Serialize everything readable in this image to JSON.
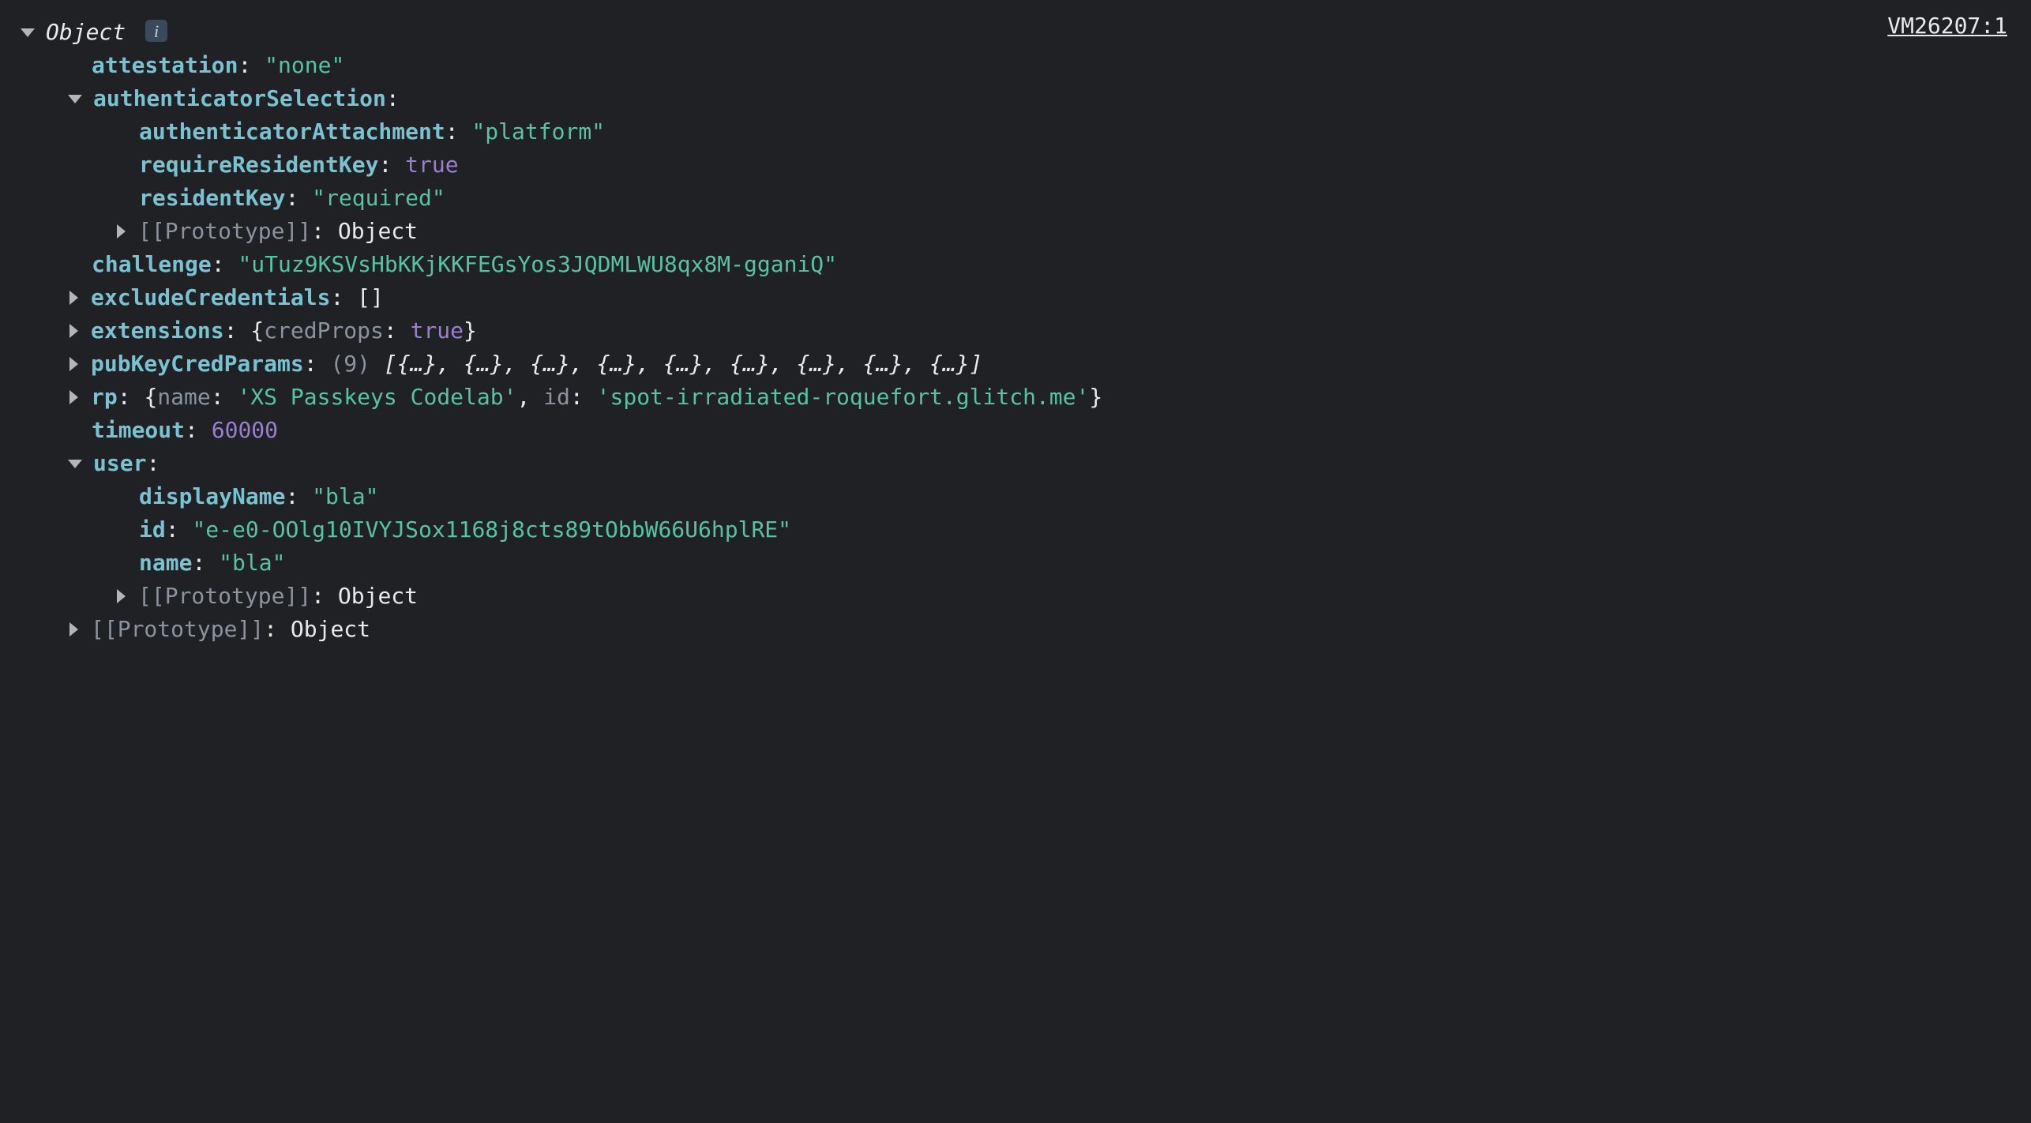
{
  "source": {
    "label": "VM26207:1"
  },
  "root": {
    "label": "Object"
  },
  "props": {
    "attestation": {
      "key": "attestation",
      "value": "\"none\""
    },
    "authenticatorSelection": {
      "key": "authenticatorSelection",
      "authenticatorAttachment": {
        "key": "authenticatorAttachment",
        "value": "\"platform\""
      },
      "requireResidentKey": {
        "key": "requireResidentKey",
        "value": "true"
      },
      "residentKey": {
        "key": "residentKey",
        "value": "\"required\""
      },
      "proto": {
        "key": "[[Prototype]]",
        "value": "Object"
      }
    },
    "challenge": {
      "key": "challenge",
      "value": "\"uTuz9KSVsHbKKjKKFEGsYos3JQDMLWU8qx8M-gganiQ\""
    },
    "excludeCredentials": {
      "key": "excludeCredentials",
      "value": "[]"
    },
    "extensions": {
      "key": "extensions",
      "previewOpen": "{",
      "previewKey": "credProps",
      "previewVal": "true",
      "previewClose": "}"
    },
    "pubKeyCredParams": {
      "key": "pubKeyCredParams",
      "count": "(9)",
      "preview": " [{…}, {…}, {…}, {…}, {…}, {…}, {…}, {…}, {…}]"
    },
    "rp": {
      "key": "rp",
      "previewOpen": "{",
      "nameKey": "name",
      "nameVal": "'XS Passkeys Codelab'",
      "idKey": "id",
      "idVal": "'spot-irradiated-roquefort.glitch.me'",
      "previewClose": "}"
    },
    "timeout": {
      "key": "timeout",
      "value": "60000"
    },
    "user": {
      "key": "user",
      "displayName": {
        "key": "displayName",
        "value": "\"bla\""
      },
      "id": {
        "key": "id",
        "value": "\"e-e0-OOlg10IVYJSox1168j8cts89tObbW66U6hplRE\""
      },
      "name": {
        "key": "name",
        "value": "\"bla\""
      },
      "proto": {
        "key": "[[Prototype]]",
        "value": "Object"
      }
    },
    "proto": {
      "key": "[[Prototype]]",
      "value": "Object"
    }
  }
}
